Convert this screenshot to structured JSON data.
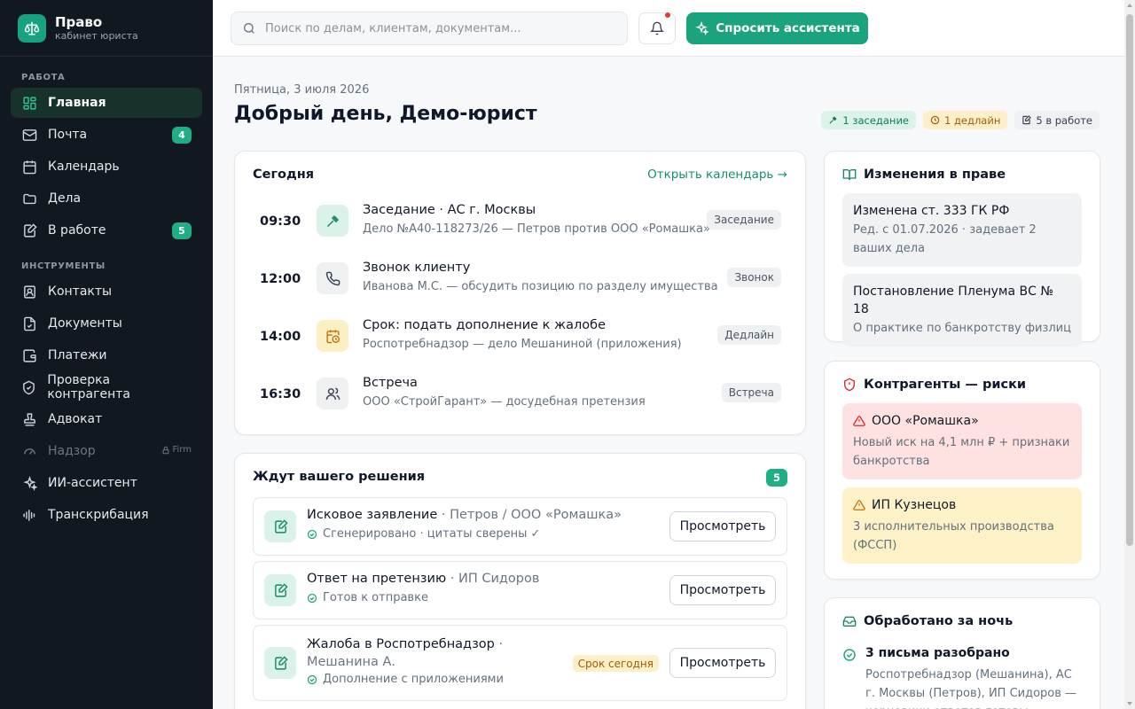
{
  "brand": {
    "title": "Право",
    "subtitle": "кабинет юриста"
  },
  "nav": {
    "section_work": "РАБОТА",
    "section_tools": "ИНСТРУМЕНТЫ",
    "items": [
      {
        "label": "Главная",
        "icon": "dashboard-icon"
      },
      {
        "label": "Почта",
        "icon": "mail-icon",
        "badge": "4"
      },
      {
        "label": "Календарь",
        "icon": "calendar-icon"
      },
      {
        "label": "Дела",
        "icon": "folder-icon"
      },
      {
        "label": "В работе",
        "icon": "edit-doc-icon",
        "badge": "5"
      },
      {
        "label": "Контакты",
        "icon": "contacts-icon"
      },
      {
        "label": "Документы",
        "icon": "document-icon"
      },
      {
        "label": "Платежи",
        "icon": "wallet-icon"
      },
      {
        "label": "Проверка контрагента",
        "icon": "shield-check-icon"
      },
      {
        "label": "Адвокат",
        "icon": "stamp-icon"
      },
      {
        "label": "Надзор",
        "icon": "gauge-icon",
        "lock": "Firm"
      },
      {
        "label": "ИИ-ассистент",
        "icon": "sparkles-icon"
      },
      {
        "label": "Транскрибация",
        "icon": "audio-wave-icon"
      }
    ]
  },
  "topbar": {
    "search_placeholder": "Поиск по делам, клиентам, документам...",
    "ask_button": "Спросить ассистента"
  },
  "header": {
    "date": "Пятница, 3 июля 2026",
    "greeting": "Добрый день, Демо-юрист",
    "chips": [
      "1 заседание",
      "1 дедлайн",
      "5 в работе"
    ]
  },
  "today": {
    "title": "Сегодня",
    "open_calendar": "Открыть календарь →",
    "events": [
      {
        "time": "09:30",
        "title": "Заседание · АС г. Москвы",
        "subtitle": "Дело №А40-118273/26 — Петров против ООО «Ромашка»",
        "tag": "Заседание",
        "icon": "gavel-icon"
      },
      {
        "time": "12:00",
        "title": "Звонок клиенту",
        "subtitle": "Иванова М.С. — обсудить позицию по разделу имущества",
        "tag": "Звонок",
        "icon": "phone-icon"
      },
      {
        "time": "14:00",
        "title": "Срок: подать дополнение к жалобе",
        "subtitle": "Роспотребнадзор — дело Мешаниной (приложения)",
        "tag": "Дедлайн",
        "icon": "calendar-clock-icon"
      },
      {
        "time": "16:30",
        "title": "Встреча",
        "subtitle": "ООО «СтройГарант» — досудебная претензия",
        "tag": "Встреча",
        "icon": "users-icon"
      }
    ]
  },
  "decisions": {
    "title": "Ждут вашего решения",
    "count": "5",
    "view_label": "Просмотреть",
    "items": [
      {
        "title": "Исковое заявление",
        "party": " · Петров / ООО «Ромашка»",
        "status": "Сгенерировано · цитаты сверены ✓"
      },
      {
        "title": "Ответ на претензию",
        "party": " · ИП Сидоров",
        "status": "Готов к отправке"
      },
      {
        "title": "Жалоба в Роспотребнадзор",
        "party": " · Мешанина А.",
        "status": "Дополнение с приложениями",
        "tag": "Срок сегодня"
      }
    ]
  },
  "law_changes": {
    "title": "Изменения в праве",
    "items": [
      {
        "title": "Изменена ст. 333 ГК РФ",
        "subtitle": "Ред. с 01.07.2026 · задевает 2 ваших дела"
      },
      {
        "title": "Постановление Пленума ВС № 18",
        "subtitle": "О практике по банкротству физлиц"
      }
    ]
  },
  "risks": {
    "title": "Контрагенты — риски",
    "items": [
      {
        "title": "ООО «Ромашка»",
        "subtitle": "Новый иск на 4,1 млн ₽ + признаки банкротства",
        "level": "high"
      },
      {
        "title": "ИП Кузнецов",
        "subtitle": "3 исполнительных производства (ФССП)",
        "level": "medium"
      }
    ]
  },
  "overnight": {
    "title": "Обработано за ночь",
    "item_title": "3 письма разобрано",
    "item_subtitle": "Роспотребнадзор (Мешанина), АС г. Москвы (Петров), ИП Сидоров — черновики ответов готовы"
  },
  "colors": {
    "accent": "#1aa37e",
    "sidebar": "#111820",
    "danger": "#e53935",
    "warning": "#a15c07"
  }
}
